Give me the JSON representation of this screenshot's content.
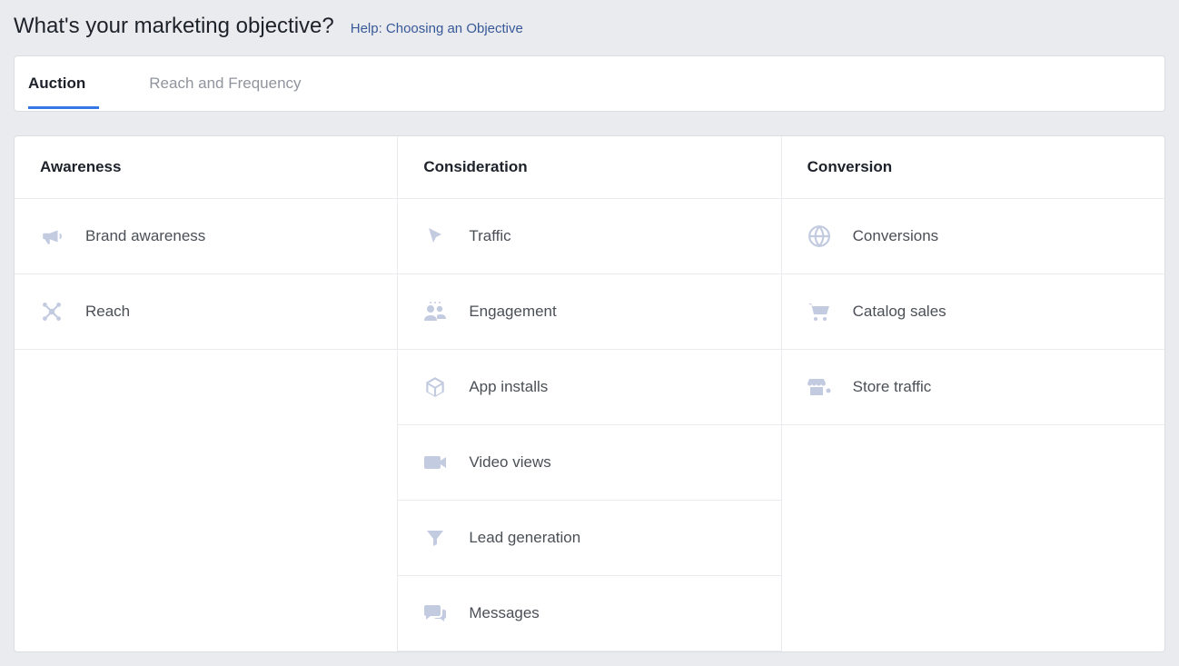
{
  "header": {
    "title": "What's your marketing objective?",
    "help_link": "Help: Choosing an Objective"
  },
  "tabs": [
    {
      "label": "Auction",
      "active": true
    },
    {
      "label": "Reach and Frequency",
      "active": false
    }
  ],
  "columns": [
    {
      "header": "Awareness",
      "items": [
        {
          "label": "Brand awareness",
          "icon": "megaphone-icon"
        },
        {
          "label": "Reach",
          "icon": "network-icon"
        }
      ]
    },
    {
      "header": "Consideration",
      "items": [
        {
          "label": "Traffic",
          "icon": "cursor-icon"
        },
        {
          "label": "Engagement",
          "icon": "people-icon"
        },
        {
          "label": "App installs",
          "icon": "box-icon"
        },
        {
          "label": "Video views",
          "icon": "video-icon"
        },
        {
          "label": "Lead generation",
          "icon": "funnel-icon"
        },
        {
          "label": "Messages",
          "icon": "chat-icon"
        }
      ]
    },
    {
      "header": "Conversion",
      "items": [
        {
          "label": "Conversions",
          "icon": "globe-icon"
        },
        {
          "label": "Catalog sales",
          "icon": "cart-icon"
        },
        {
          "label": "Store traffic",
          "icon": "store-icon"
        }
      ]
    }
  ]
}
